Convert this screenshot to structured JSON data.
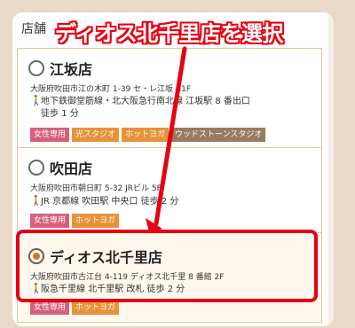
{
  "annotation": {
    "banner_text": "ディオス北千里店を選択",
    "color": "#e60012"
  },
  "form": {
    "section_label": "店舗"
  },
  "stores": [
    {
      "name": "江坂店",
      "address": "大阪府吹田市江の木町 1-39 セ・レ江坂 B1F",
      "access_line1": "地下鉄御堂筋線・北大阪急行南北線 江坂駅 8 番出口",
      "access_line2": "徒歩 1 分",
      "tags": [
        "女性専用",
        "光スタジオ",
        "ホットヨガ",
        "ウッドストーンスタジオ"
      ],
      "selected": false
    },
    {
      "name": "吹田店",
      "address": "大阪府吹田市朝日町 5-32 JRビル 5F",
      "access_line1": "JR 京都線 吹田駅 中央口 徒歩 2 分",
      "tags": [
        "女性専用",
        "ホットヨガ"
      ],
      "selected": false
    },
    {
      "name": "ディオス北千里店",
      "address": "大阪府吹田市古江台 4-119 ディオス北千里 8 番館 2F",
      "access_line1": "阪急千里線 北千里駅 改札 徒歩 2 分",
      "tags": [
        "女性専用",
        "ホットヨガ"
      ],
      "selected": true
    }
  ]
}
